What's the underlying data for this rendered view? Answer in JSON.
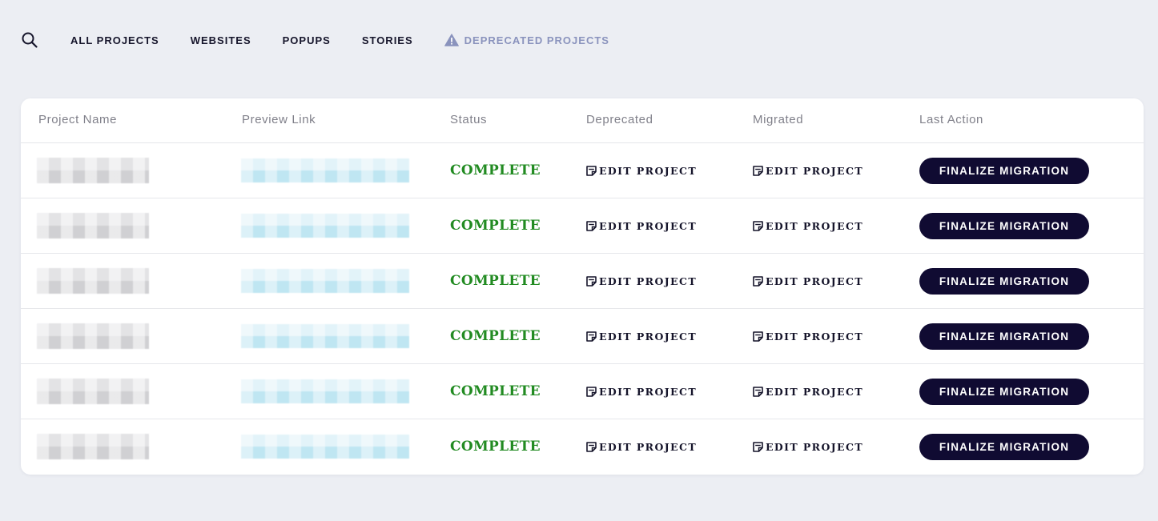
{
  "nav": {
    "search_icon": "search-icon",
    "tabs": [
      {
        "label": "ALL PROJECTS"
      },
      {
        "label": "WEBSITES"
      },
      {
        "label": "POPUPS"
      },
      {
        "label": "STORIES"
      }
    ],
    "deprecated_tab": {
      "label": "DEPRECATED PROJECTS",
      "icon": "warning-icon",
      "color": "#8a93bd"
    }
  },
  "table": {
    "columns": [
      "Project Name",
      "Preview Link",
      "Status",
      "Deprecated",
      "Migrated",
      "Last Action"
    ],
    "rows": [
      {
        "status": "COMPLETE",
        "deprecated": "EDIT PROJECT",
        "migrated": "EDIT PROJECT",
        "action": "FINALIZE MIGRATION"
      },
      {
        "status": "COMPLETE",
        "deprecated": "EDIT PROJECT",
        "migrated": "EDIT PROJECT",
        "action": "FINALIZE MIGRATION"
      },
      {
        "status": "COMPLETE",
        "deprecated": "EDIT PROJECT",
        "migrated": "EDIT PROJECT",
        "action": "FINALIZE MIGRATION"
      },
      {
        "status": "COMPLETE",
        "deprecated": "EDIT PROJECT",
        "migrated": "EDIT PROJECT",
        "action": "FINALIZE MIGRATION"
      },
      {
        "status": "COMPLETE",
        "deprecated": "EDIT PROJECT",
        "migrated": "EDIT PROJECT",
        "action": "FINALIZE MIGRATION"
      },
      {
        "status": "COMPLETE",
        "deprecated": "EDIT PROJECT",
        "migrated": "EDIT PROJECT",
        "action": "FINALIZE MIGRATION"
      }
    ]
  },
  "colors": {
    "status_complete": "#228b22",
    "button_bg": "#100b32",
    "page_bg": "#eceef3"
  }
}
